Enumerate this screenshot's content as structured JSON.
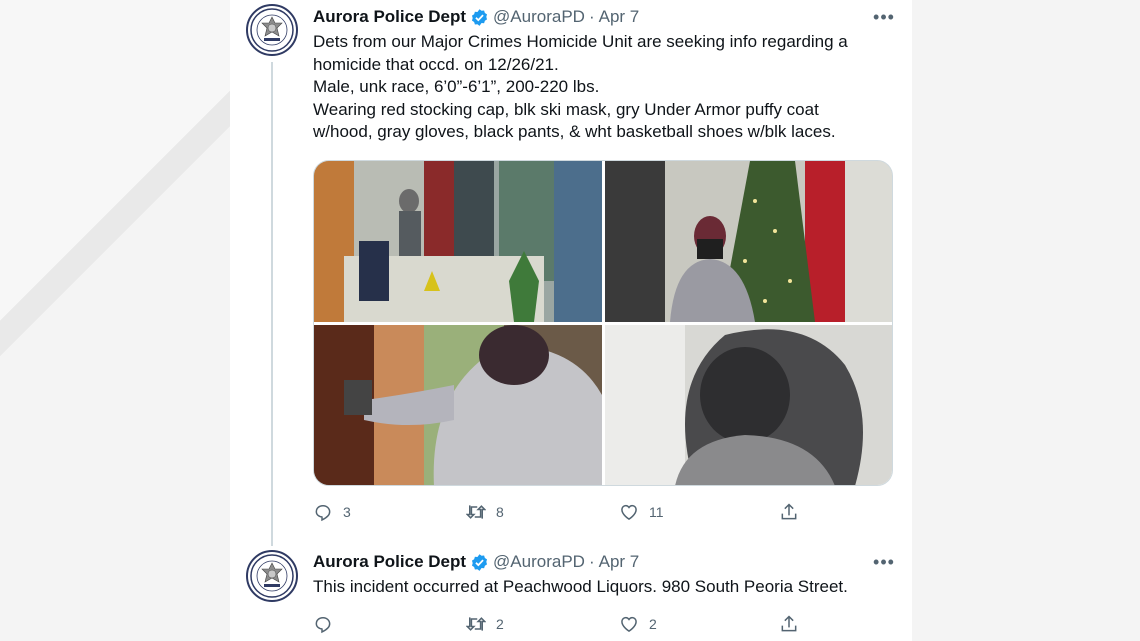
{
  "tweets": [
    {
      "author": "Aurora Police Dept",
      "handle": "@AuroraPD",
      "separator": "·",
      "date": "Apr 7",
      "more_label": "•••",
      "text_lines": [
        "Dets from our Major Crimes Homicide Unit are seeking info regarding a",
        "homicide that occd. on 12/26/21.",
        "Male, unk race, 6’0”-6’1”, 200-220 lbs.",
        "Wearing red stocking cap, blk ski mask, gry Under Armor puffy coat",
        "w/hood, gray gloves, black pants, & wht basketball shoes w/blk laces."
      ],
      "replies": "3",
      "retweets": "8",
      "likes": "11"
    },
    {
      "author": "Aurora Police Dept",
      "handle": "@AuroraPD",
      "separator": "·",
      "date": "Apr 7",
      "more_label": "•••",
      "text": "This incident occurred at Peachwood Liquors. 980 South Peoria Street.",
      "replies": "",
      "retweets": "2",
      "likes": "2"
    }
  ],
  "icons": {
    "verified": "verified-badge-icon",
    "reply": "reply-icon",
    "retweet": "retweet-icon",
    "like": "heart-icon",
    "share": "share-icon",
    "avatar": "police-badge-logo"
  },
  "colors": {
    "text": "#0f1419",
    "muted": "#536471",
    "verified": "#1d9bf0",
    "border": "#cfd9de"
  }
}
